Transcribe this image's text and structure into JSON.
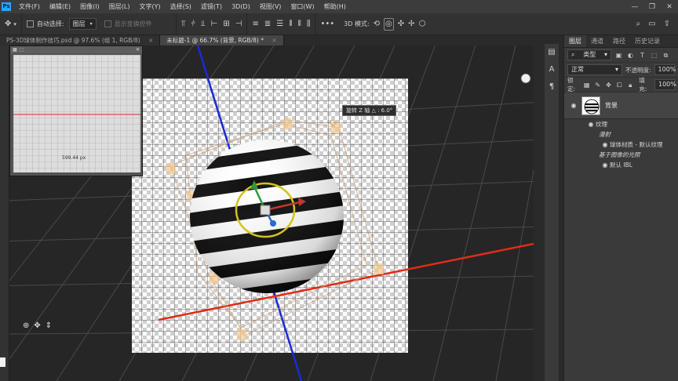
{
  "menu": {
    "logo": "Ps",
    "items": [
      "文件(F)",
      "编辑(E)",
      "图像(I)",
      "图层(L)",
      "文字(Y)",
      "选择(S)",
      "滤镜(T)",
      "3D(D)",
      "视图(V)",
      "窗口(W)",
      "帮助(H)"
    ],
    "window_controls": [
      "—",
      "❐",
      "✕"
    ]
  },
  "options": {
    "auto_select_label": "自动选择:",
    "auto_select_target": "图层",
    "show_transform_controls": "显示变换控件",
    "mode_3d_label": "3D 模式:"
  },
  "tabs": [
    {
      "label": "PS-3D球体制作技巧.psd @ 97.6% (组 1, RGB/8)",
      "close": "×"
    },
    {
      "label": "未标题-1 @ 66.7% (背景, RGB/8) *",
      "close": "×"
    }
  ],
  "canvas": {
    "tooltip": "旋转 Z 轴 △ : 6.0°",
    "docwin_readout": "599.44 px"
  },
  "layers_panel": {
    "tabs": [
      "图层",
      "通道",
      "路径",
      "历史记录"
    ],
    "filter_kind": "类型",
    "blend_mode": "正常",
    "opacity_label": "不透明度:",
    "opacity_value": "100%",
    "lock_label": "锁定:",
    "fill_label": "填充:",
    "fill_value": "100%",
    "layer_name": "背景",
    "sub_items": [
      "纹理",
      "漫射",
      "球体材质 - 默认纹理",
      "基于图像的光照",
      "默认 IBL"
    ]
  },
  "colors": {
    "accent_x_axis": "#e03020",
    "accent_z_axis": "#2030e0",
    "gizmo_ring": "#d4c21a"
  }
}
